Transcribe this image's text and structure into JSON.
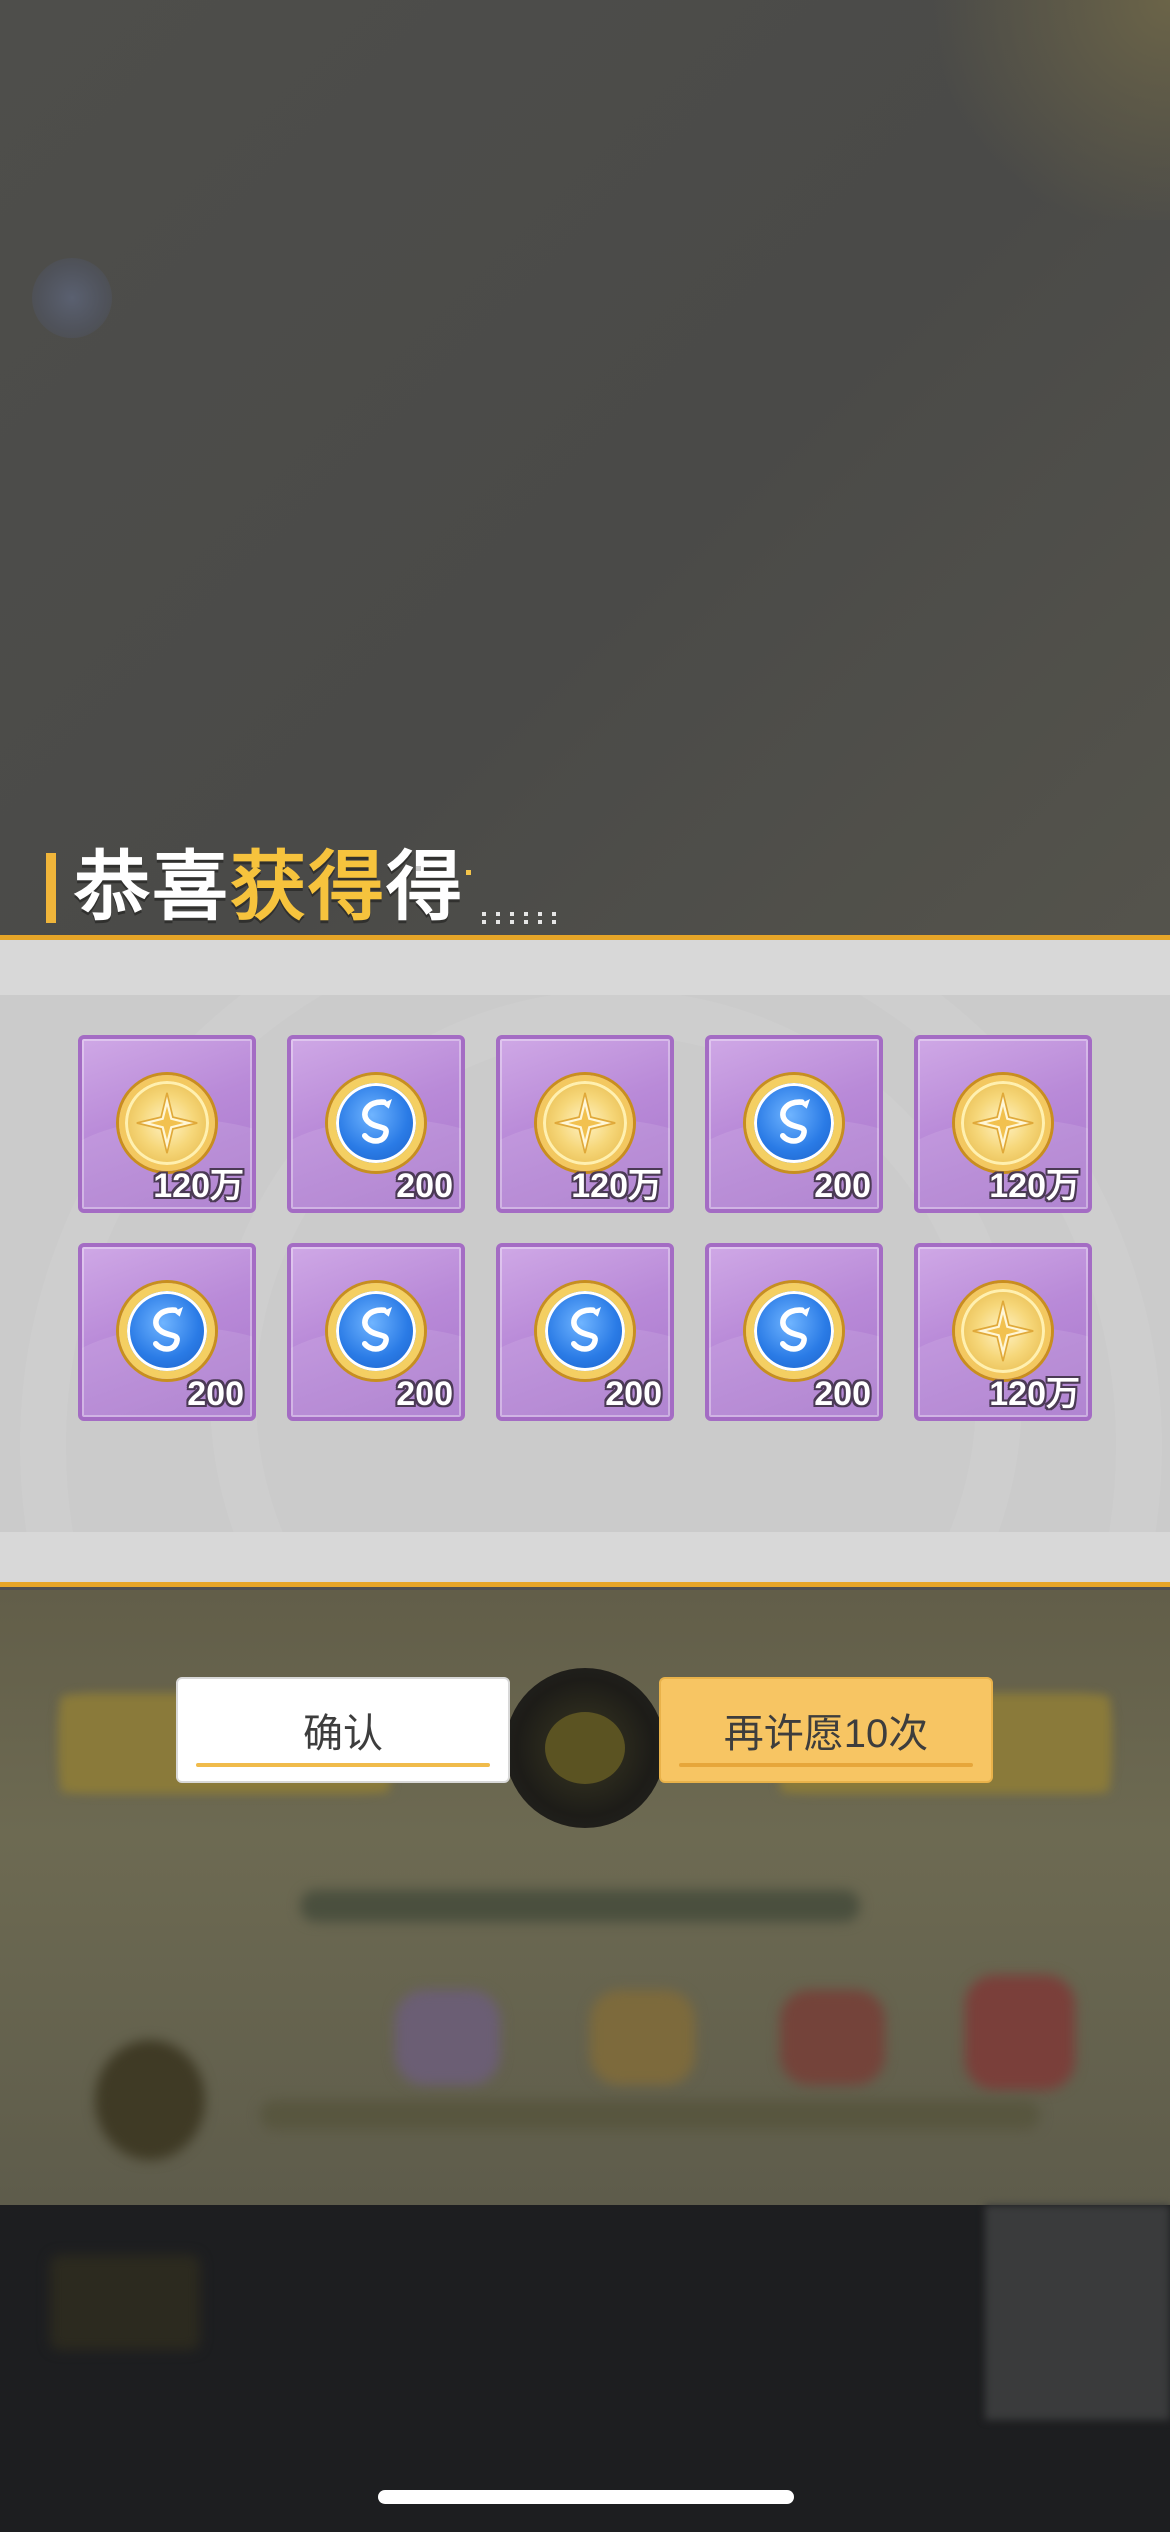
{
  "result_dialog": {
    "title_part1": "恭喜",
    "title_highlight": "获得",
    "title_part2": "得",
    "rewards": [
      {
        "icon": "gold-coin-icon",
        "amount": "120万"
      },
      {
        "icon": "blue-dragon-coin-icon",
        "amount": "200"
      },
      {
        "icon": "gold-coin-icon",
        "amount": "120万"
      },
      {
        "icon": "blue-dragon-coin-icon",
        "amount": "200"
      },
      {
        "icon": "gold-coin-icon",
        "amount": "120万"
      },
      {
        "icon": "blue-dragon-coin-icon",
        "amount": "200"
      },
      {
        "icon": "blue-dragon-coin-icon",
        "amount": "200"
      },
      {
        "icon": "blue-dragon-coin-icon",
        "amount": "200"
      },
      {
        "icon": "blue-dragon-coin-icon",
        "amount": "200"
      },
      {
        "icon": "gold-coin-icon",
        "amount": "120万"
      }
    ],
    "confirm_label": "确认",
    "again_label": "再许愿10次"
  },
  "colors": {
    "accent_gold": "#e6a528",
    "title_highlight": "#f6c33d",
    "card_purple": "#b98ad8",
    "button_gold": "#f7c563"
  }
}
